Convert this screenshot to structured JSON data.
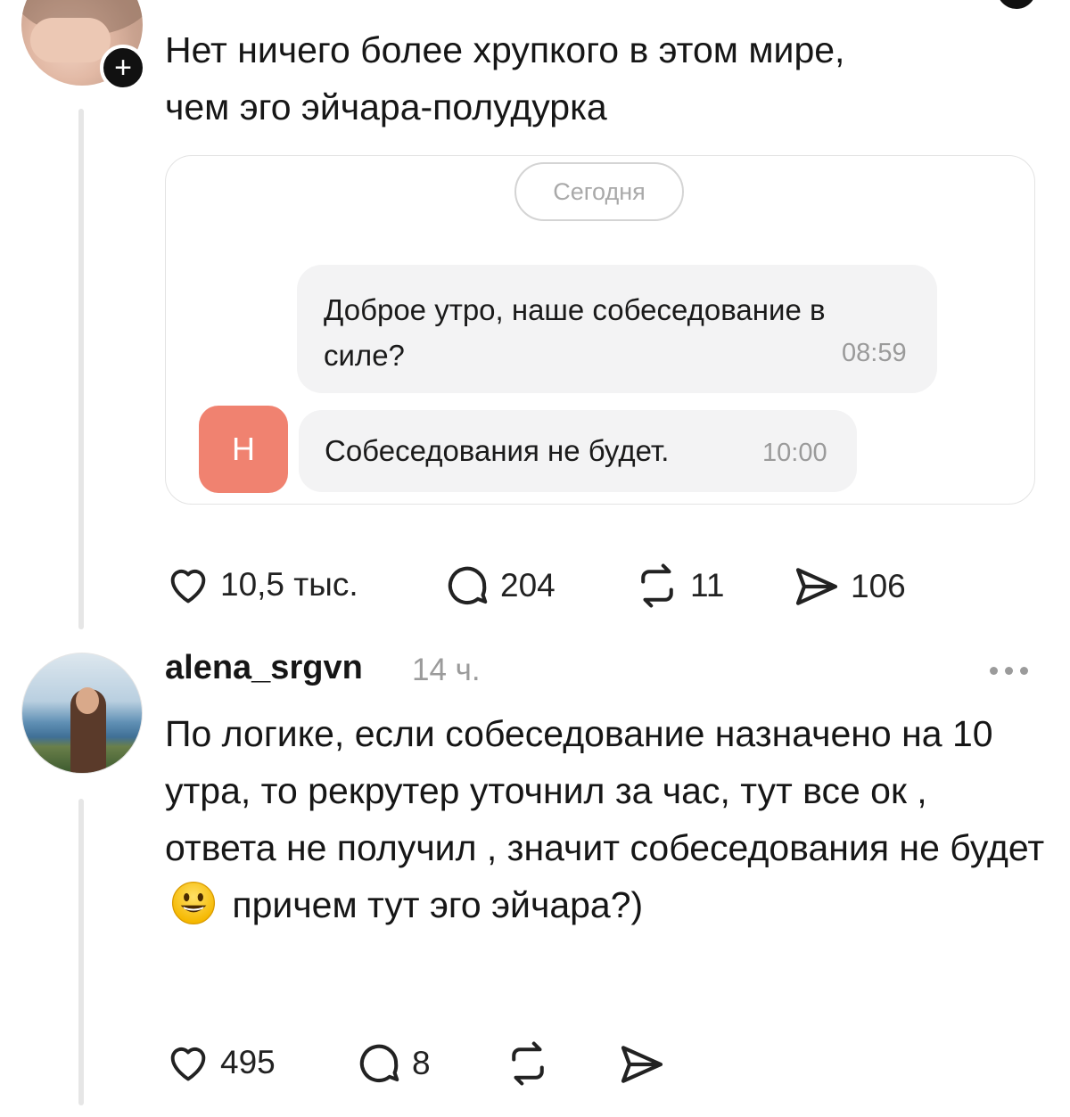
{
  "post": {
    "text": "Нет ничего более хрупкого в этом мире,\nчем эго эйчара-полудурка",
    "chat": {
      "date_label": "Сегодня",
      "outgoing": {
        "text": "Доброе утро, наше собеседование в\nсиле?",
        "time": "08:59"
      },
      "sender_initial": "Н",
      "incoming": {
        "text": "Собеседования не будет.",
        "time": "10:00"
      }
    },
    "actions": {
      "likes": "10,5 тыс.",
      "replies": "204",
      "reposts": "11",
      "shares": "106"
    }
  },
  "comment": {
    "username": "alena_srgvn",
    "time": "14 ч.",
    "text_before_emoji": "По логике, если собеседование назначено на 10 утра, то рекрутер уточнил за час, тут все ок , ответа не получил , значит собеседования не будет",
    "emoji": "smiling-face-icon",
    "text_after_emoji": "причем тут эго эйчара?)",
    "actions": {
      "likes": "495",
      "replies": "8"
    }
  },
  "colors": {
    "avatar_badge": "#f08270",
    "muted": "#9b9b9b",
    "bubble": "#f3f3f4"
  }
}
